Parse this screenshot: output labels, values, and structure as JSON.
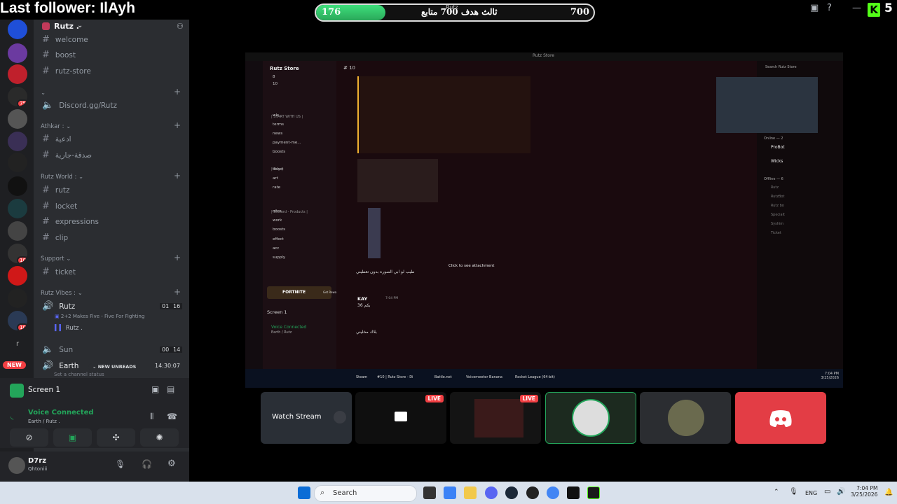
{
  "overlay": {
    "last_follower": "Last follower: IlAyh",
    "goal_current": "176",
    "goal_target": "700",
    "goal_text": "ثالث هدف 700 متابع",
    "goal_small": "Rutz",
    "goal_progress": 0.25,
    "viewer_count": "5",
    "kick_logo": "K"
  },
  "server": {
    "name": "Rutz .",
    "channels_top": [
      "welcome",
      "boost",
      "rutz-store"
    ],
    "link_channel": "Discord.gg/Rutz",
    "categories": [
      {
        "name": "Athkar :",
        "channels": [
          "ادعية",
          "صدقة-جارية"
        ]
      },
      {
        "name": "Rutz World :",
        "channels": [
          "rutz",
          "locket",
          "expressions",
          "clip"
        ]
      },
      {
        "name": "Support",
        "channels": [
          "ticket"
        ]
      },
      {
        "name": "Rutz Vibes :",
        "channels": []
      }
    ],
    "voice": {
      "rutz": {
        "name": "Rutz",
        "count_a": "01",
        "count_b": "16",
        "activity": "2+2 Makes Five - Five For Fighting",
        "member": "Rutz ."
      },
      "sun": {
        "name": "Sun",
        "count_a": "00",
        "count_b": "14"
      },
      "earth": {
        "name": "Earth",
        "timer": "14:30:07",
        "status_placeholder": "Set a channel status"
      }
    },
    "new_unreads": "NEW UNREADS",
    "new_badge": "NEW"
  },
  "rail_badges": [
    "75",
    "10",
    "10"
  ],
  "screen_panel": {
    "title": "Screen 1",
    "voice_connected": "Voice Connected",
    "voice_location": "Earth / Rutz ."
  },
  "user": {
    "name": "D7rz",
    "status": "Qhtoniii"
  },
  "tiles": {
    "watch_stream": "Watch Stream",
    "live": "LIVE"
  },
  "taskbar": {
    "search": "Search",
    "lang": "ENG",
    "time": "7:04 PM",
    "date": "3/25/2026"
  },
  "inner": {
    "title": "Rutz Store",
    "channel": "10",
    "search": "Search Rutz Store",
    "channels": [
      "8",
      "10",
      "wlc",
      "terms",
      "news",
      "payment-me...",
      "boosts",
      "ticket",
      "art",
      "rate",
      "nitro",
      "work",
      "boosts",
      "effect",
      "acc",
      "supply"
    ],
    "cat_start": "| START WITH US |",
    "cat_buy": "| Buy |",
    "cat_products": "| Discord - Products |",
    "panel_title": "Screen 1",
    "voice_connected": "Voice Connected",
    "voice_location": "Earth / Rutz",
    "msg_name": "KAY",
    "msg_time": "7:04 PM",
    "msg_click": "Click to see attachment",
    "msg_text_1": "طيب لو ابي الصوره بدون تعطيني",
    "msg_text_2": "بكم 36",
    "msg_text_3": "بلاك مخليني",
    "online_header": "Online — 2",
    "offline_header": "Offline — 6",
    "members": [
      "ProBot",
      "Wicks"
    ],
    "offline_members": [
      "Rutz",
      "RutzBot",
      "Rutz bo",
      "Specialt",
      "Syshim",
      "Ticket"
    ],
    "taskbar_items": [
      "Steam",
      "#10 | Rutz Store - Di",
      "Battle.net",
      "Voicemeeter Banana",
      "Rocket League (64-bit)"
    ],
    "time": "7:04 PM",
    "date": "3/25/2026",
    "fortnite": "FORTNITE",
    "reward": "Get Reward"
  },
  "colors": {
    "rail": "#1e1f22",
    "sidebar": "#2b2d31",
    "accent_green": "#23a55a",
    "discord_red": "#f23f43",
    "blurple": "#5865f2",
    "goal_fill": "#3ee07c"
  }
}
